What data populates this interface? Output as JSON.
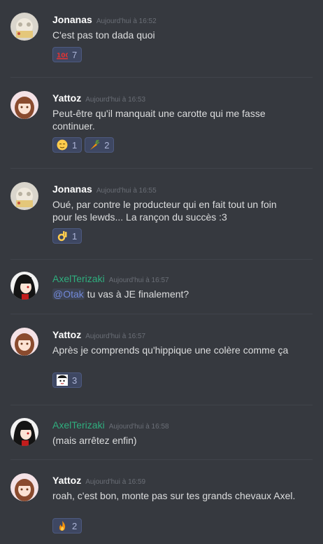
{
  "messages": [
    {
      "author": "Jonanas",
      "timestamp": "Aujourd'hui à 16:52",
      "text": "C'est pas ton dada quoi",
      "reactions": [
        {
          "emoji": "100-icon",
          "count": "7"
        }
      ]
    },
    {
      "author": "Yattoz",
      "timestamp": "Aujourd'hui à 16:53",
      "text": "Peut-être qu'il manquait une carotte qui me fasse continuer.",
      "reactions": [
        {
          "emoji": "relieved-face-icon",
          "count": "1"
        },
        {
          "emoji": "carrot-icon",
          "count": "2"
        }
      ]
    },
    {
      "author": "Jonanas",
      "timestamp": "Aujourd'hui à 16:55",
      "text": "Oué, par contre le producteur qui en fait tout un foin pour les lewds... La rançon du succès  :3",
      "reactions": [
        {
          "emoji": "ok-hand-icon",
          "count": "1"
        }
      ]
    },
    {
      "author": "AxelTerizaki",
      "timestamp": "Aujourd'hui à 16:57",
      "mention": "@Otak",
      "text": " tu vas à JE finalement?",
      "reactions": []
    },
    {
      "author": "Yattoz",
      "timestamp": "Aujourd'hui à 16:57",
      "text": "Après je comprends qu'hippique une colère comme ça",
      "reactions": [
        {
          "emoji": "custom-face-icon",
          "count": "3"
        }
      ]
    },
    {
      "author": "AxelTerizaki",
      "timestamp": "Aujourd'hui à 16:58",
      "text": "(mais arrêtez enfin)",
      "reactions": []
    },
    {
      "author": "Yattoz",
      "timestamp": "Aujourd'hui à 16:59",
      "text": "roah, c'est bon, monte pas sur tes grands chevaux Axel.",
      "reactions": [
        {
          "emoji": "fire-icon",
          "count": "2"
        }
      ]
    }
  ],
  "colors": {
    "background": "#36393f",
    "author": "#ffffff",
    "author_green": "#2fae7e",
    "reaction_bg": "#3e4762",
    "mention": "#7289da"
  }
}
